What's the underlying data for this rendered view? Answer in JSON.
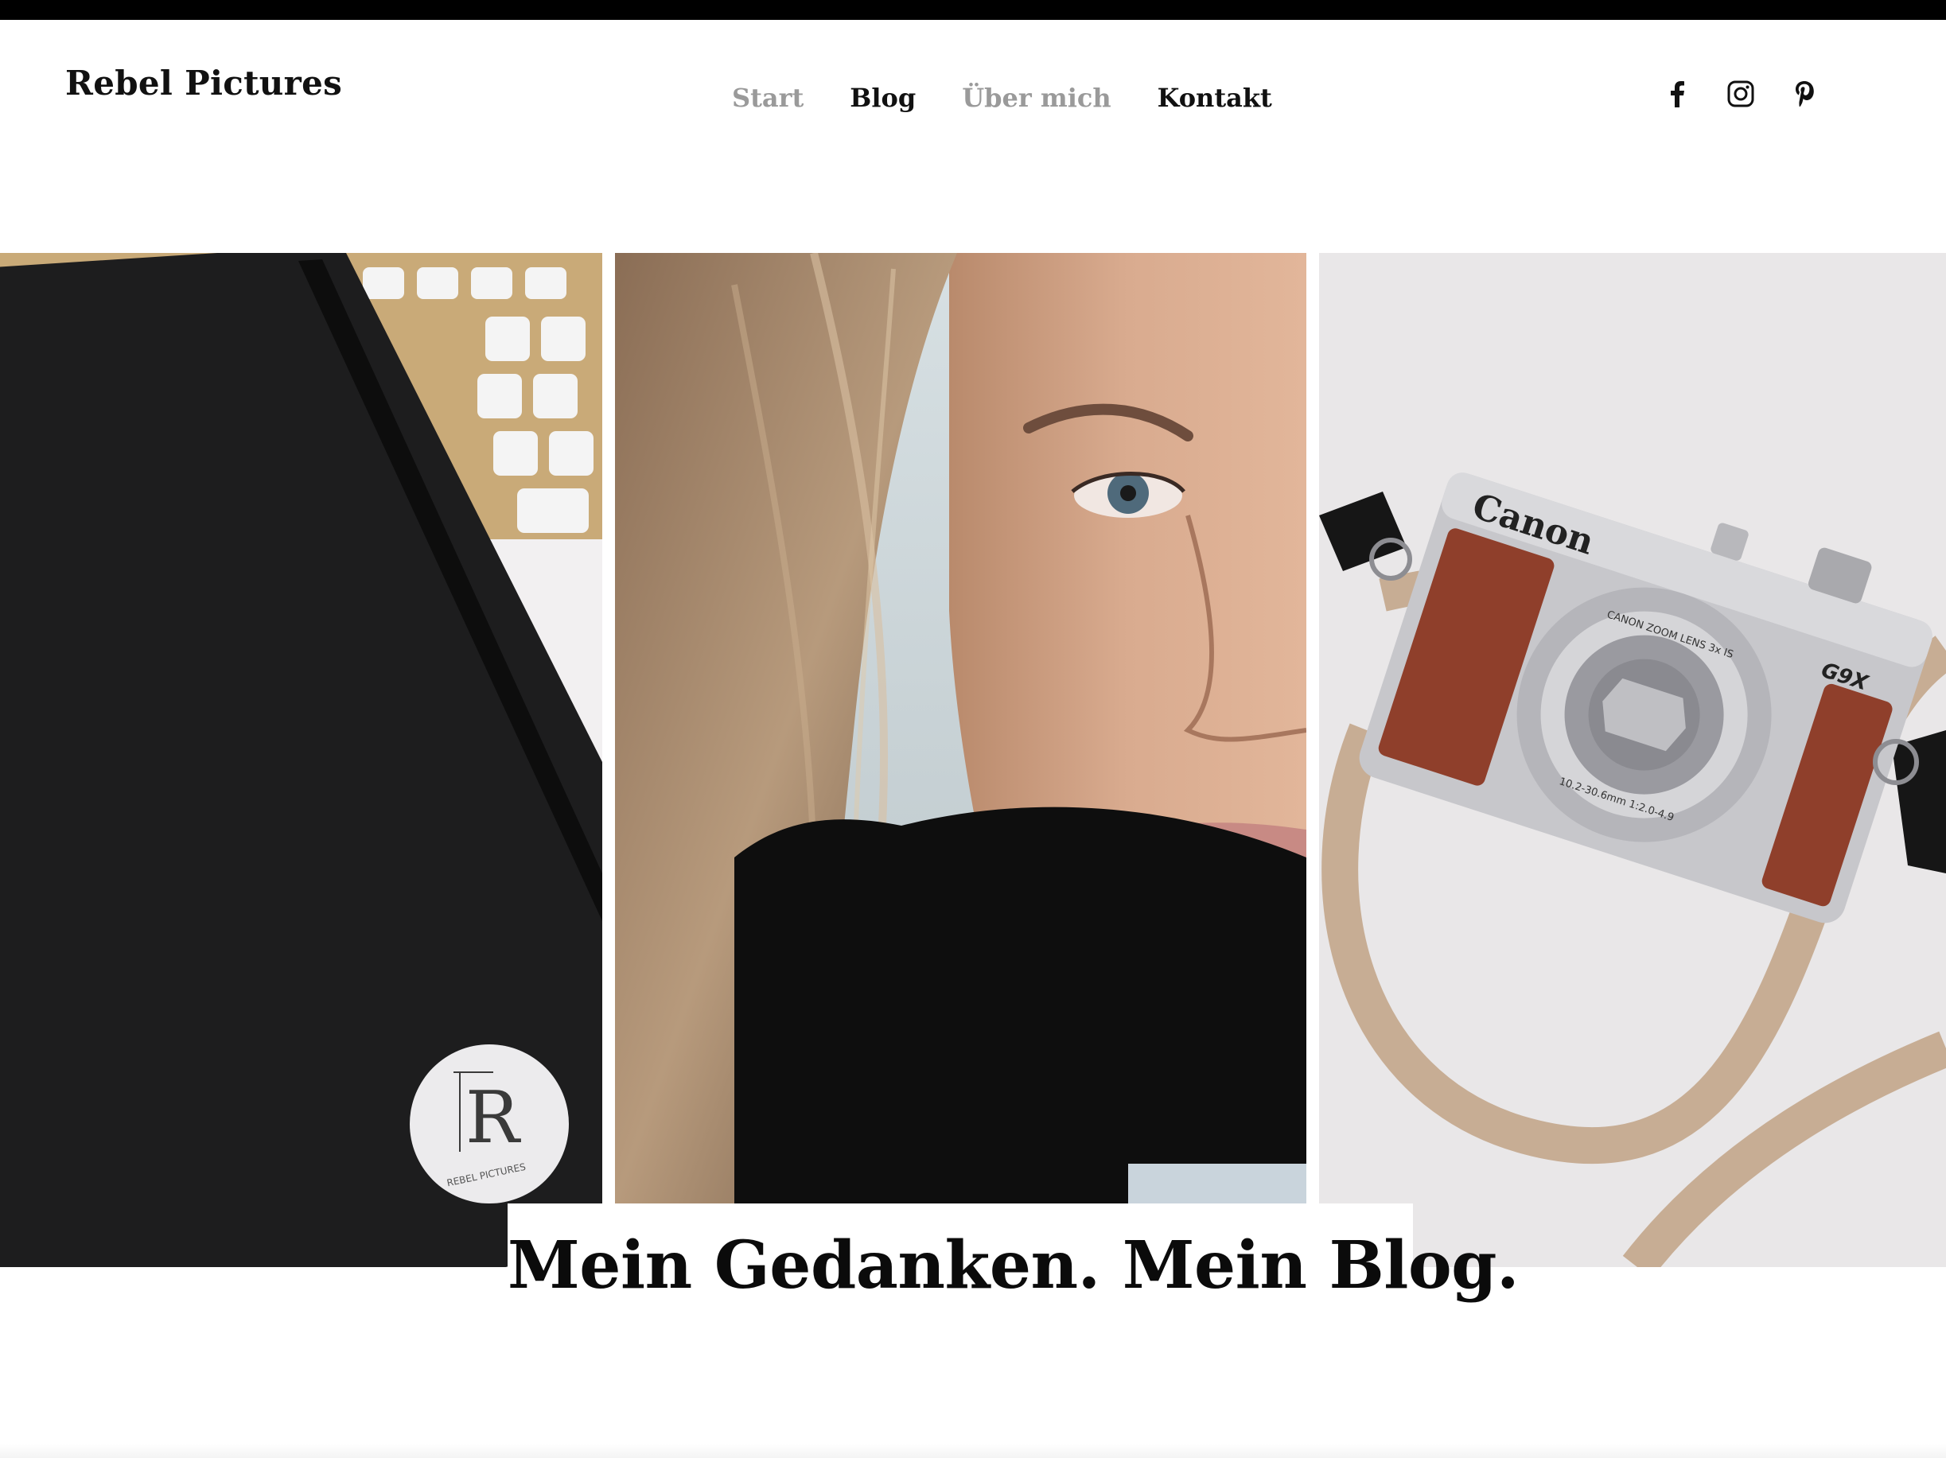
{
  "header": {
    "site_title": "Rebel Pictures"
  },
  "nav": {
    "items": [
      {
        "label": "Start"
      },
      {
        "label": "Blog"
      },
      {
        "label": "Über mich"
      },
      {
        "label": "Kontakt"
      }
    ]
  },
  "social": {
    "icons": [
      "facebook-icon",
      "instagram-icon",
      "pinterest-icon"
    ]
  },
  "gallery": {
    "notebook_sticker_text": "REBEL PICTURES",
    "camera_brand": "Canon",
    "camera_model": "G9X",
    "lens_text": "CANON ZOOM LENS 3x IS",
    "lens_spec": "10.2-30.6mm 1:2.0-4.9"
  },
  "hero": {
    "tagline": "Mein Gedanken. Mein Blog."
  },
  "colors": {
    "text": "#111111",
    "nav_muted": "#9a9a9a",
    "top_bar": "#000000"
  }
}
